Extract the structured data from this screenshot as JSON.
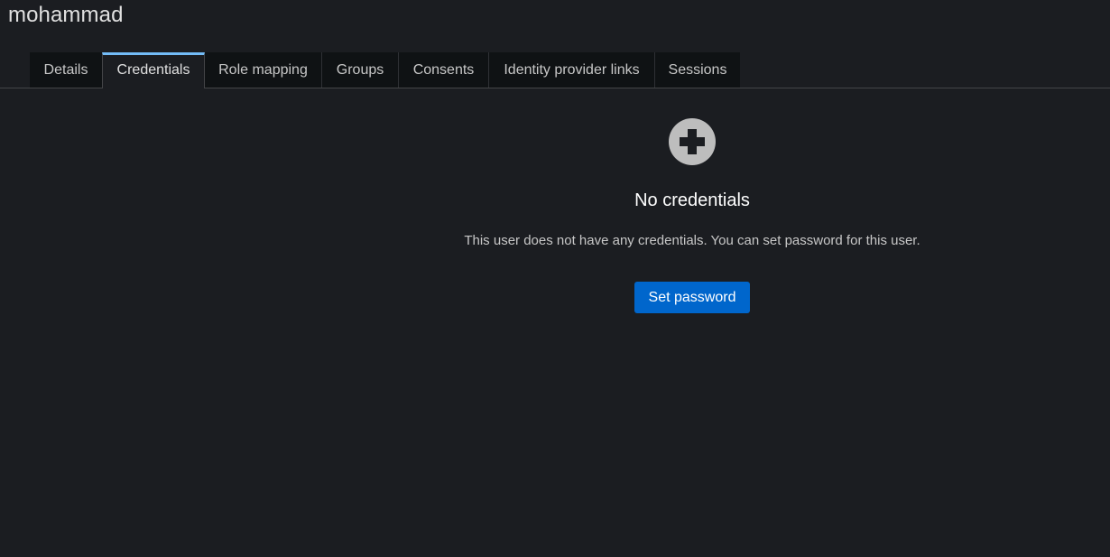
{
  "header": {
    "username": "mohammad"
  },
  "tabs": [
    {
      "label": "Details",
      "active": false
    },
    {
      "label": "Credentials",
      "active": true
    },
    {
      "label": "Role mapping",
      "active": false
    },
    {
      "label": "Groups",
      "active": false
    },
    {
      "label": "Consents",
      "active": false
    },
    {
      "label": "Identity provider links",
      "active": false
    },
    {
      "label": "Sessions",
      "active": false
    }
  ],
  "empty_state": {
    "icon": "plus-circle-icon",
    "title": "No credentials",
    "body": "This user does not have any credentials. You can set password for this user.",
    "action_label": "Set password"
  },
  "colors": {
    "background": "#1b1d21",
    "tab_background": "#0f1214",
    "active_tab_indicator": "#73bcf7",
    "primary_button": "#0066cc",
    "icon": "#bdbdbd"
  }
}
